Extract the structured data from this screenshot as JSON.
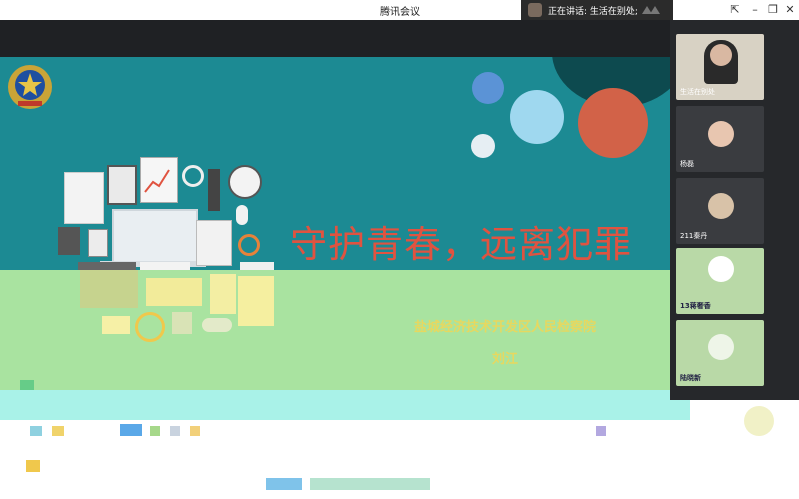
{
  "window": {
    "title": "腾讯会议",
    "speaking_label": "正在讲话: 生活在别处;"
  },
  "slide": {
    "title": "守护青春，远离犯罪",
    "organization": "盐城经济技术开发区人民检察院",
    "speaker": "刘江"
  },
  "participants": [
    {
      "name": "生活在别处",
      "avatar_color": "#b8b2a6"
    },
    {
      "name": "杨磊",
      "avatar_color": "#e8c6b0"
    },
    {
      "name": "211秦丹",
      "avatar_color": "#d8c2a8"
    },
    {
      "name": "13蒋奢香",
      "avatar_color": "#ffffff"
    },
    {
      "name": "陆晓新",
      "avatar_color": "#eef5e8"
    }
  ],
  "colors": {
    "slide_teal": "#1c8a93",
    "title_red": "#e05340",
    "org_yellow": "#e6d860"
  }
}
